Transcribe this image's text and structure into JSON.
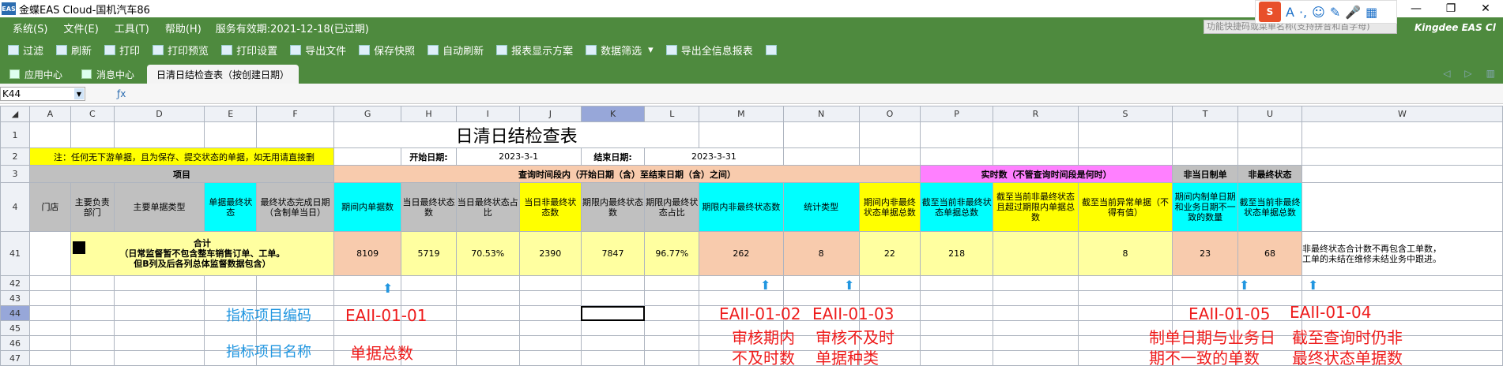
{
  "app": {
    "title": "金蝶EAS Cloud-国机汽车86",
    "logo": "EAS"
  },
  "menu": {
    "items": [
      "系统(S)",
      "文件(E)",
      "工具(T)",
      "帮助(H)"
    ],
    "service": "服务有效期:2021-12-18(已过期)",
    "search_placeholder": "功能快捷码或菜单名称(支持拼音和首字母)",
    "brand": "Kingdee",
    "brand_suffix": "EAS Cl"
  },
  "ime": {
    "logo": "S",
    "icons": [
      "A",
      "·,",
      "☺",
      "✎",
      "🎤",
      "▦"
    ]
  },
  "toolbar": {
    "items": [
      "过滤",
      "刷新",
      "打印",
      "打印预览",
      "打印设置",
      "导出文件",
      "保存快照",
      "自动刷新",
      "报表显示方案",
      "数据筛选",
      "导出全信息报表"
    ]
  },
  "tabs": {
    "items": [
      "应用中心",
      "消息中心",
      "日清日结检查表（按创建日期）"
    ]
  },
  "formula": {
    "cell": "K44"
  },
  "sheet": {
    "cols": [
      "A",
      "C",
      "D",
      "E",
      "F",
      "G",
      "H",
      "I",
      "J",
      "K",
      "L",
      "M",
      "N",
      "O",
      "P",
      "R",
      "S",
      "T",
      "U",
      "W"
    ],
    "rows": [
      "1",
      "2",
      "3",
      "4",
      "41",
      "42",
      "43",
      "44",
      "45",
      "46",
      "47"
    ],
    "title": "日清日结检查表",
    "note": "注：任何无下游单据，且为保存、提交状态的单据，如无用请直接删",
    "start_label": "开始日期:",
    "start_value": "2023-3-1",
    "end_label": "结束日期:",
    "end_value": "2023-3-31",
    "group_item": "项目",
    "group_query": "查询时间段内（开始日期（含）至结束日期（含）之间）",
    "group_realtime": "实时数（不管查询时间段是何时）",
    "group_nonday": "非当日制单",
    "group_nonfinal": "非最终状态",
    "h_store": "门店",
    "h_dept": "主要负责部门",
    "h_type": "主要单据类型",
    "h_final": "单据最终状态",
    "h_finaldate": "最终状态完成日期（含制单当日）",
    "h_G": "期间内单据数",
    "h_H": "当日最终状态数",
    "h_I": "当日最终状态占比",
    "h_J": "当日非最终状态数",
    "h_K": "期限内最终状态数",
    "h_L": "期限内最终状态占比",
    "h_M": "期限内非最终状态数",
    "h_N": "统计类型",
    "h_O": "期间内非最终状态单据总数",
    "h_P": "截至当前非最终状态单据总数",
    "h_R": "截至当前非最终状态且超过期限内单据总数",
    "h_S": "截至当前异常单据（不得有值）",
    "h_T": "期间内制单日期和业务日期不一致的数量",
    "h_U": "截至当前非最终状态单据总数",
    "total_line1": "合计",
    "total_line2": "（日常监督暂不包含整车销售订单、工单。",
    "total_line3": "但B列及后各列总体监督数据包含）",
    "v_G": "8109",
    "v_H": "5719",
    "v_I": "70.53%",
    "v_J": "2390",
    "v_K": "7847",
    "v_L": "96.77%",
    "v_M": "262",
    "v_N": "8",
    "v_O": "22",
    "v_P": "218",
    "v_S": "8",
    "v_T": "23",
    "v_U": "68",
    "w_note1": "非最终状态合计数不再包含工单数，",
    "w_note2": "工单的未结在维修未结业务中跟进。"
  },
  "annotations": {
    "code_label": "指标项目编码",
    "name_label": "指标项目名称",
    "g_code": "EAII-01-01",
    "g_name": "单据总数",
    "m_code": "EAII-01-02",
    "m_name1": "审核期内",
    "m_name2": "不及时数",
    "n_code": "EAII-01-03",
    "n_name1": "审核不及时",
    "n_name2": "单据种类",
    "t_code": "EAII-01-05",
    "t_name1": "制单日期与业务日",
    "t_name2": "期不一致的单数",
    "u_code": "EAII-01-04",
    "u_name1": "截至查询时仍非",
    "u_name2": "最终状态单据数"
  }
}
